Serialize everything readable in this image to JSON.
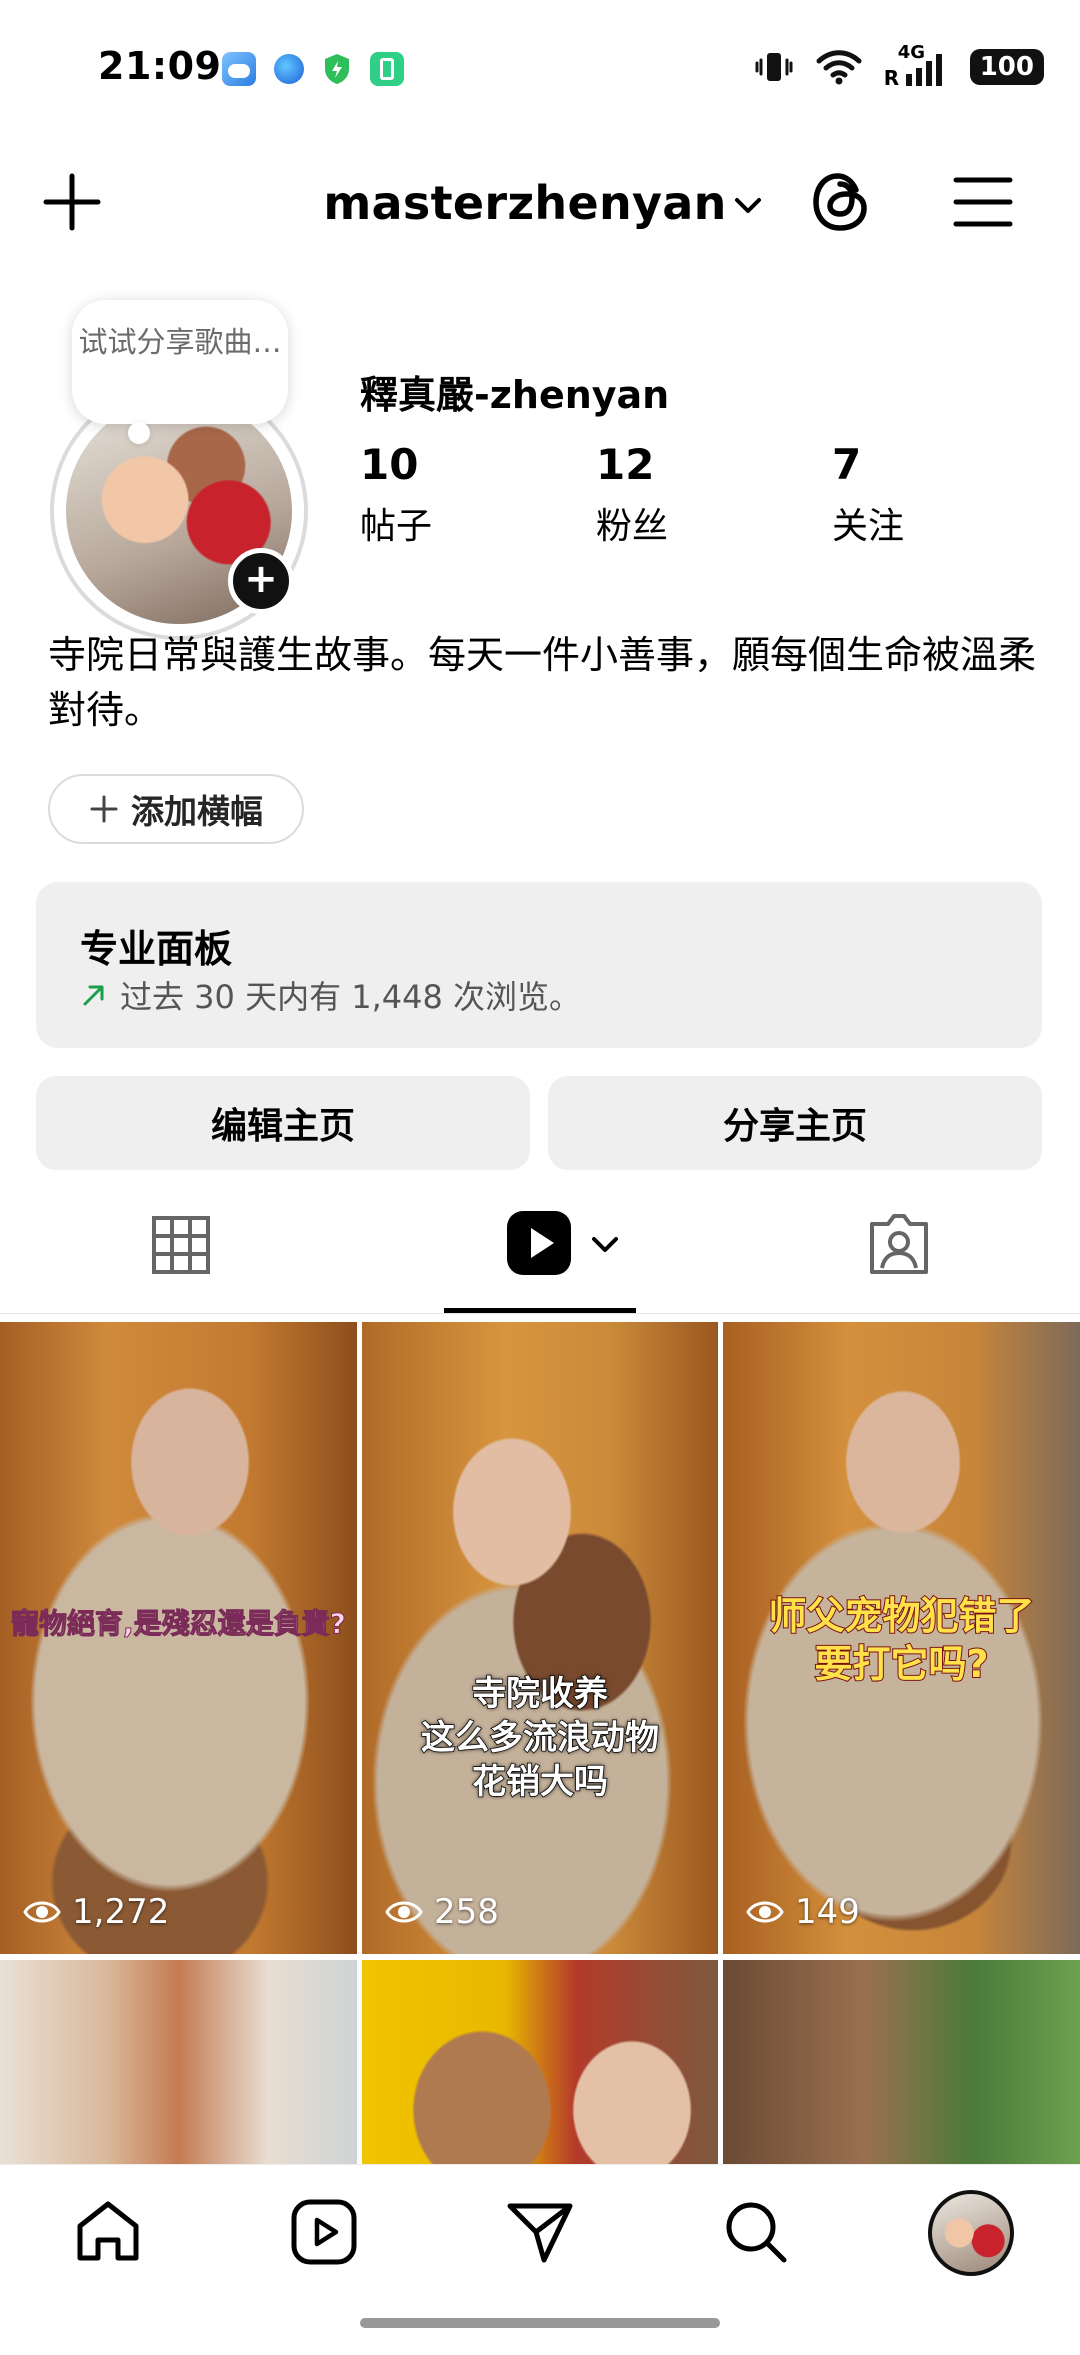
{
  "status_bar": {
    "time": "21:09",
    "network": "4G",
    "roaming": "R",
    "battery": "100",
    "left_icons": [
      "weather-icon",
      "app-icon",
      "shield-icon",
      "phone-manager-icon"
    ]
  },
  "header": {
    "username": "masterzhenyan"
  },
  "profile": {
    "note": "试试分享歌曲…",
    "display_name": "釋真嚴-zhenyan",
    "stats": [
      {
        "value": "10",
        "label": "帖子"
      },
      {
        "value": "12",
        "label": "粉丝"
      },
      {
        "value": "7",
        "label": "关注"
      }
    ],
    "bio": "寺院日常與護生故事。每天一件小善事，願每個生命被溫柔對待。",
    "add_banner_label": "添加横幅"
  },
  "pro_dashboard": {
    "title": "专业面板",
    "subtitle": "过去 30 天内有 1,448 次浏览。"
  },
  "actions": {
    "edit_profile": "编辑主页",
    "share_profile": "分享主页"
  },
  "tabs": [
    "grid",
    "reels",
    "tagged"
  ],
  "active_tab": "reels",
  "reels": [
    {
      "caption": "寵物絕育,是殘忍還是負責?",
      "views": "1,272"
    },
    {
      "caption_lines": [
        "寺院收养",
        "这么多流浪动物",
        "花销大吗"
      ],
      "views": "258"
    },
    {
      "caption_lines": [
        "师父宠物犯错了",
        "要打它吗?"
      ],
      "views": "149"
    }
  ],
  "colors": {
    "text": "#000000",
    "secondary_text": "#555555",
    "button_bg": "#efefef",
    "trend_green": "#1a9e4b",
    "border": "#dbdbdb"
  }
}
